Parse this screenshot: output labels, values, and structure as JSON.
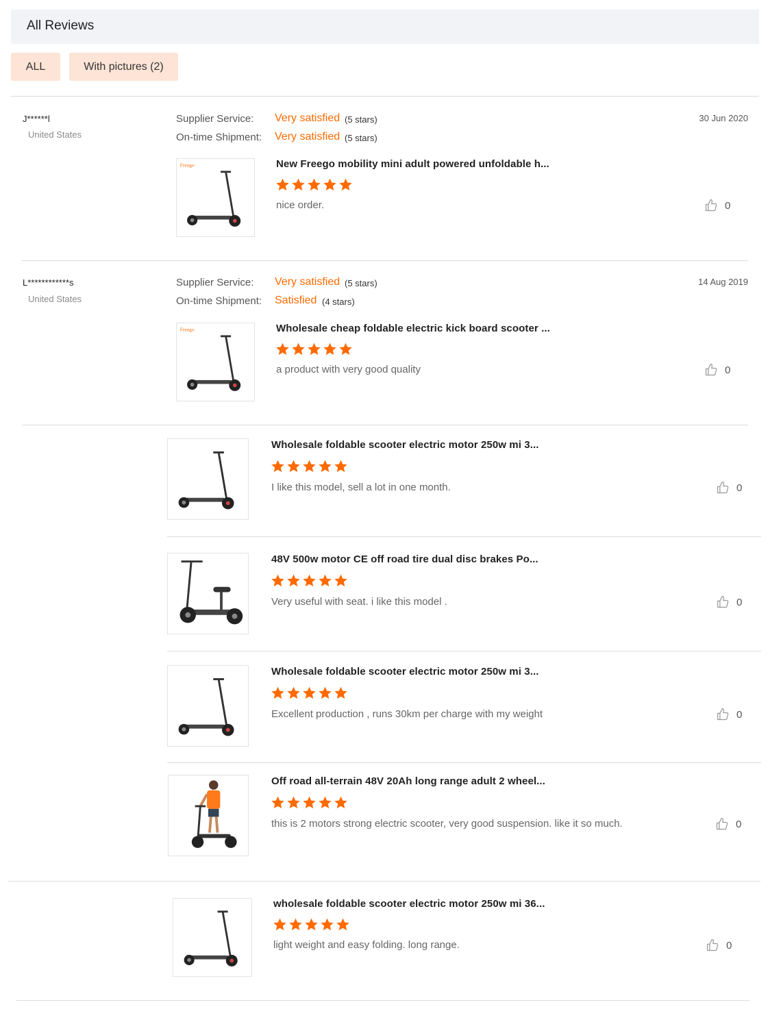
{
  "header": {
    "title": "All Reviews"
  },
  "filters": [
    {
      "label": "ALL"
    },
    {
      "label": "With pictures (2)"
    }
  ],
  "labels": {
    "supplier_service": "Supplier Service:",
    "on_time_shipment": "On-time Shipment:"
  },
  "reviews": [
    {
      "name": "J******l",
      "country": "United States",
      "date": "30 Jun 2020",
      "supplier_rating": "Very satisfied",
      "supplier_stars": "(5 stars)",
      "shipment_rating": "Very satisfied",
      "shipment_stars": "(5 stars)",
      "product_title": "New Freego mobility mini adult powered unfoldable h...",
      "rating": 5,
      "text": "nice order.",
      "likes": "0",
      "image": "scooter-freego-logo"
    },
    {
      "name": "L************s",
      "country": "United States",
      "date": "14 Aug 2019",
      "supplier_rating": "Very satisfied",
      "supplier_stars": "(5 stars)",
      "shipment_rating": "Satisfied",
      "shipment_stars": "(4 stars)",
      "product_title": "Wholesale cheap foldable electric kick board scooter ...",
      "rating": 5,
      "text": "a product with very good quality",
      "likes": "0",
      "image": "scooter-freego-logo"
    }
  ],
  "extra_reviews": [
    {
      "product_title": "Wholesale foldable scooter electric motor 250w mi 3...",
      "rating": 5,
      "text": "I like this model, sell a lot in one month.",
      "likes": "0",
      "image": "scooter"
    },
    {
      "product_title": "48V 500w motor CE off road tire dual disc brakes Po...",
      "rating": 5,
      "text": "Very useful with seat. i like this model .",
      "likes": "0",
      "image": "scooter-with-seat"
    },
    {
      "product_title": "Wholesale foldable scooter electric motor 250w mi 3...",
      "rating": 5,
      "text": "Excellent production , runs 30km per charge with my weight",
      "likes": "0",
      "image": "scooter"
    },
    {
      "product_title": "Off road all-terrain 48V 20Ah long range adult 2 wheel...",
      "rating": 5,
      "text": "this is 2 motors strong electric scooter, very good suspension. like it so much.",
      "likes": "0",
      "image": "rider-on-scooter"
    },
    {
      "product_title": "wholesale foldable scooter electric motor 250w mi 36...",
      "rating": 5,
      "text": "light weight and easy folding. long range.",
      "likes": "0",
      "image": "scooter"
    }
  ],
  "colors": {
    "accent": "#ff6a00",
    "filter_bg": "#fde4d6",
    "header_bg": "#f2f3f7"
  },
  "thumb_logo_text": "Freego"
}
